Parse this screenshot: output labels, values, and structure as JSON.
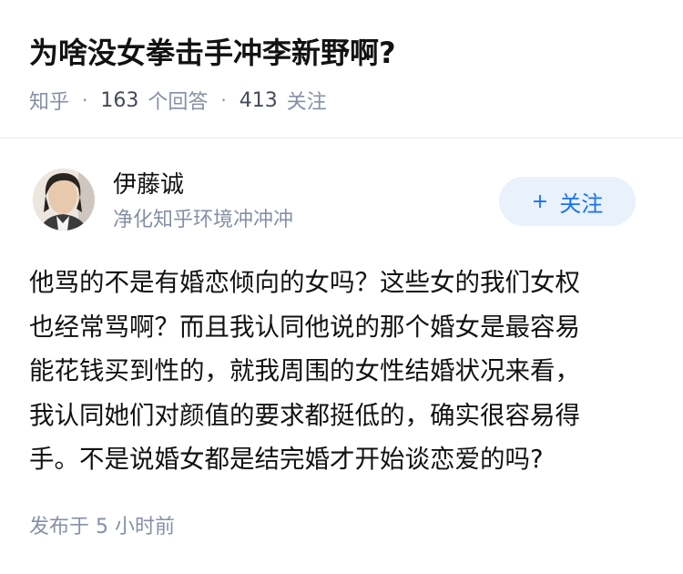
{
  "question": {
    "title": "为啥没女拳击手冲李新野啊?",
    "source": "知乎",
    "answers_count": "163",
    "answers_label": "个回答",
    "followers_count": "413",
    "followers_label": "关注"
  },
  "author": {
    "name": "伊藤诚",
    "bio": "净化知乎环境冲冲冲",
    "follow_button": {
      "icon": "+",
      "label": "关注"
    }
  },
  "answer": {
    "lines": [
      "他骂的不是有婚恋倾向的女吗？这些女的我们女权",
      "也经常骂啊？而且我认同他说的那个婚女是最容易",
      "能花钱买到性的，就我周围的女性结婚状况来看，",
      "我认同她们对颜值的要求都挺低的，确实很容易得",
      "手。不是说婚女都是结完婚才开始谈恋爱的吗?"
    ],
    "published": "发布于  5 小时前"
  },
  "colors": {
    "title": "#121212",
    "meta": "#8590a6",
    "follow_bg": "#e9f1fb",
    "follow_text": "#1772f6",
    "divider": "#ebebeb"
  }
}
